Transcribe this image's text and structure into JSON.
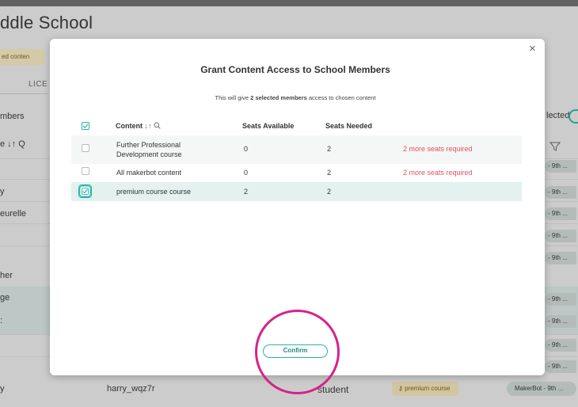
{
  "background": {
    "page_title": "ddle School",
    "chip_label": "ed conten",
    "tab_label": "LICE",
    "left_labels": {
      "members": "mbers",
      "name_sort": "e ↓↑ Q",
      "row_y1": "y",
      "row_eurelle": "eurelle",
      "row_her": "her",
      "row_ge": "ge",
      "row_colon": ":"
    },
    "selected_label": "lected",
    "grade_pill_label": "- 9th ...",
    "bottom_row": {
      "left_text": "y",
      "username": "harry_wqz7r",
      "role": "student",
      "course_badge": "premium course",
      "org_badge": "MakerBot - 9th ..."
    }
  },
  "modal": {
    "close_symbol": "×",
    "title": "Grant Content Access to School Members",
    "subtitle_prefix": "This will give ",
    "subtitle_bold": "2 selected members",
    "subtitle_suffix": " access to chosen content",
    "columns": {
      "content": "Content",
      "seats_available": "Seats Available",
      "seats_needed": "Seats Needed"
    },
    "rows": [
      {
        "content": [
          "Further Professional",
          "Development course"
        ],
        "seats_available": "0",
        "seats_needed": "2",
        "warning": "2 more seats required",
        "checked": false
      },
      {
        "content": [
          "All makerbot content"
        ],
        "seats_available": "0",
        "seats_needed": "2",
        "warning": "2 more seats required",
        "checked": false
      },
      {
        "content": [
          "premium course course"
        ],
        "seats_available": "2",
        "seats_needed": "2",
        "warning": "",
        "checked": true
      }
    ],
    "confirm_label": "Confirm"
  },
  "colors": {
    "accent": "#2ab3a6",
    "warning": "#e0525a",
    "highlight_circle": "#d6228a",
    "selected_row": "#e3f1ef"
  }
}
